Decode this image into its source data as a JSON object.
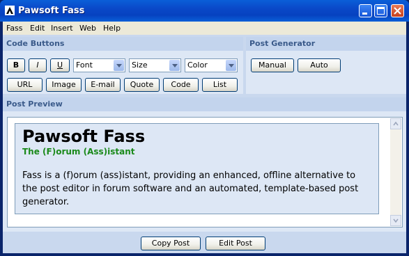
{
  "window": {
    "title": "Pawsoft Fass"
  },
  "menu": [
    "Fass",
    "Edit",
    "Insert",
    "Web",
    "Help"
  ],
  "code_buttons": {
    "heading": "Code Buttons",
    "bold": "B",
    "italic": "I",
    "underline": "U",
    "font_select": "Font",
    "size_select": "Size",
    "color_select": "Color",
    "url": "URL",
    "image": "Image",
    "email": "E-mail",
    "quote": "Quote",
    "code": "Code",
    "list": "List"
  },
  "post_generator": {
    "heading": "Post Generator",
    "manual": "Manual",
    "auto": "Auto"
  },
  "post_preview": {
    "heading": "Post Preview",
    "title": "Pawsoft Fass",
    "subtitle": "The (F)orum (Ass)istant",
    "body": "Fass is a (f)orum (ass)istant, providing an enhanced, offline alternative to the post editor in forum software and an automated, template-based post generator."
  },
  "footer": {
    "copy_post": "Copy Post",
    "edit_post": "Edit Post"
  }
}
